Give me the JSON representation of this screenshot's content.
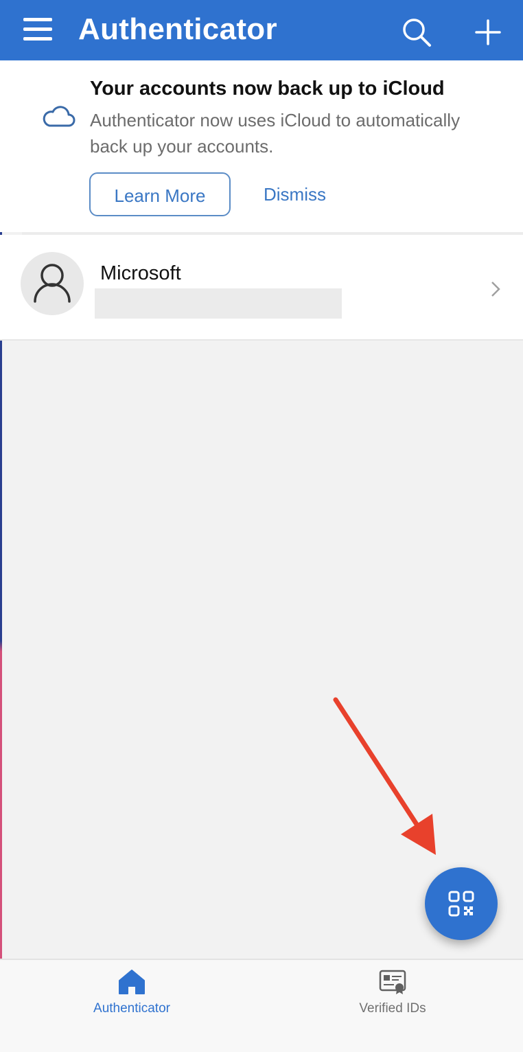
{
  "header": {
    "title": "Authenticator",
    "menu_icon": "hamburger-menu-icon",
    "search_icon": "search-icon",
    "add_icon": "plus-icon"
  },
  "banner": {
    "icon": "cloud-icon",
    "title": "Your accounts now back up to iCloud",
    "body": "Authenticator now uses iCloud to automatically back up your accounts.",
    "learn_more_label": "Learn More",
    "dismiss_label": "Dismiss"
  },
  "accounts": [
    {
      "name": "Microsoft",
      "email_redacted": true,
      "icon": "user-avatar-icon"
    }
  ],
  "fab": {
    "icon": "qr-code-scan-icon"
  },
  "annotation": {
    "icon": "red-arrow-pointer",
    "color": "#e8412c"
  },
  "tabbar": {
    "tabs": [
      {
        "label": "Authenticator",
        "icon": "home-icon",
        "active": true
      },
      {
        "label": "Verified IDs",
        "icon": "id-card-icon",
        "active": false
      }
    ]
  },
  "colors": {
    "brand_blue": "#2f72cf",
    "link_blue": "#3a77c4",
    "background": "#f2f2f2"
  }
}
